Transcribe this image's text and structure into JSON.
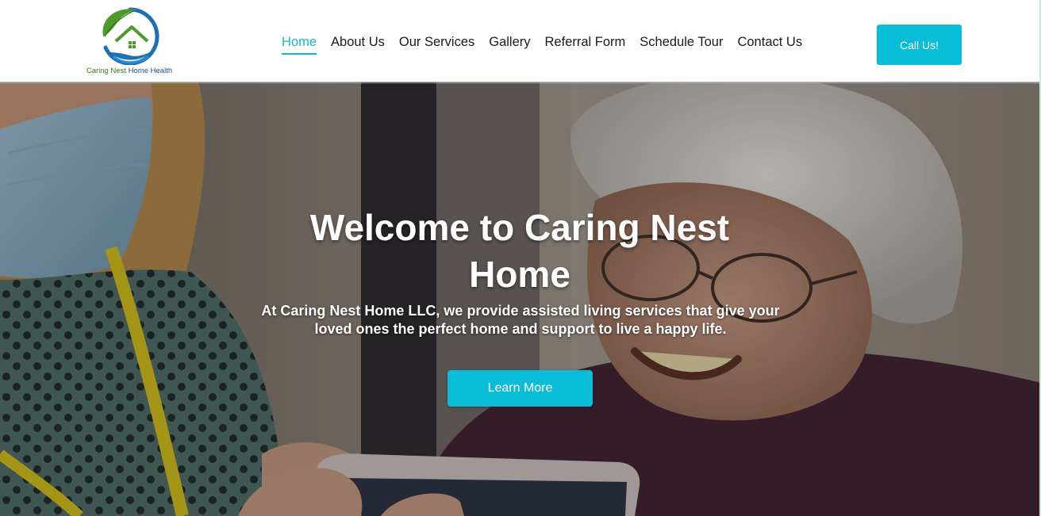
{
  "brand": {
    "logo_word1": "Caring Nest",
    "logo_word2": "Home Health",
    "icon": "house-leaf-logo-icon"
  },
  "nav": {
    "items": [
      {
        "label": "Home",
        "active": true
      },
      {
        "label": "About Us"
      },
      {
        "label": "Our Services"
      },
      {
        "label": "Gallery"
      },
      {
        "label": "Referral Form"
      },
      {
        "label": "Schedule Tour"
      },
      {
        "label": "Contact Us"
      }
    ]
  },
  "header": {
    "call_label": "Call Us!"
  },
  "hero": {
    "title": "Welcome to Caring Nest Home",
    "subtitle": "At Caring Nest Home LLC, we provide assisted living services that give your loved ones the perfect home and support to live a happy life.",
    "cta_label": "Learn More"
  },
  "colors": {
    "accent": "#09bcd8",
    "active_nav": "#12b4d3",
    "logo_green": "#3e7d1f",
    "logo_blue": "#1b4f8a"
  }
}
